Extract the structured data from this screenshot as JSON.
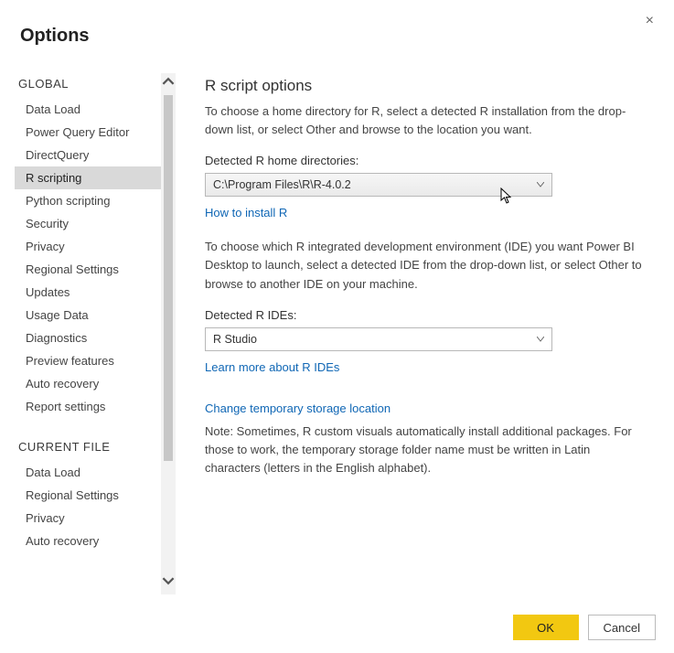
{
  "title": "Options",
  "close_icon": "×",
  "sidebar": {
    "section1_header": "GLOBAL",
    "section1_items": [
      "Data Load",
      "Power Query Editor",
      "DirectQuery",
      "R scripting",
      "Python scripting",
      "Security",
      "Privacy",
      "Regional Settings",
      "Updates",
      "Usage Data",
      "Diagnostics",
      "Preview features",
      "Auto recovery",
      "Report settings"
    ],
    "selected_index": 3,
    "section2_header": "CURRENT FILE",
    "section2_items": [
      "Data Load",
      "Regional Settings",
      "Privacy",
      "Auto recovery"
    ]
  },
  "main": {
    "heading": "R script options",
    "desc1": "To choose a home directory for R, select a detected R installation from the drop-down list, or select Other and browse to the location you want.",
    "label1": "Detected R home directories:",
    "dropdown1_value": "C:\\Program Files\\R\\R-4.0.2",
    "link1": "How to install R",
    "desc2": "To choose which R integrated development environment (IDE) you want Power BI Desktop to launch, select a detected IDE from the drop-down list, or select Other to browse to another IDE on your machine.",
    "label2": "Detected R IDEs:",
    "dropdown2_value": "R Studio",
    "link2": "Learn more about R IDEs",
    "link3": "Change temporary storage location",
    "note": "Note: Sometimes, R custom visuals automatically install additional packages. For those to work, the temporary storage folder name must be written in Latin characters (letters in the English alphabet)."
  },
  "footer": {
    "ok": "OK",
    "cancel": "Cancel"
  }
}
